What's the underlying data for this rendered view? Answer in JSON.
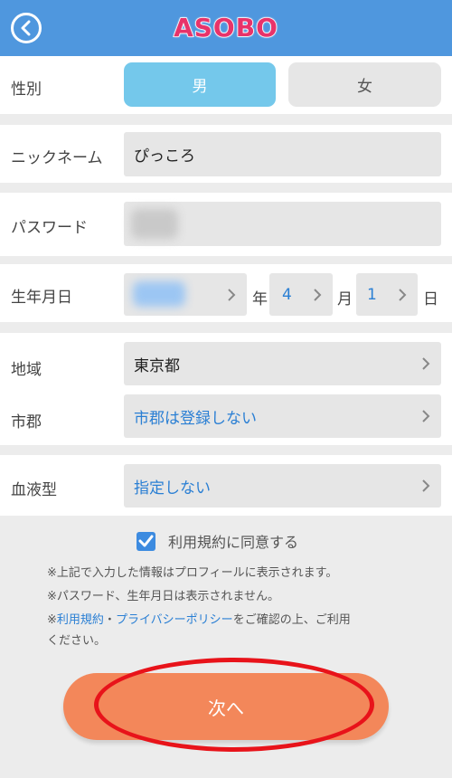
{
  "header": {
    "logo": "ASOBO"
  },
  "gender": {
    "label": "性別",
    "male": "男",
    "female": "女",
    "selected": "男"
  },
  "nickname": {
    "label": "ニックネーム",
    "value": "ぴっころ"
  },
  "password": {
    "label": "パスワード"
  },
  "birthday": {
    "label": "生年月日",
    "year_suffix": "年",
    "month": "4",
    "month_suffix": "月",
    "day": "1",
    "day_suffix": "日"
  },
  "region": {
    "label": "地域",
    "value": "東京都"
  },
  "city": {
    "label": "市郡",
    "value": "市郡は登録しない"
  },
  "blood": {
    "label": "血液型",
    "value": "指定しない"
  },
  "agree": {
    "label": "利用規約に同意する",
    "checked": true
  },
  "notes": {
    "line1": "※上記で入力した情報はプロフィールに表示されます。",
    "line2": "※パスワード、生年月日は表示されません。",
    "prefix": "※",
    "terms_link": "利用規約",
    "separator": "・",
    "privacy_link": "プライバシーポリシー",
    "suffix": "をご確認の上、ご利用",
    "line4": "ください。"
  },
  "next_button": "次へ",
  "colors": {
    "header": "#4f97de",
    "logo": "#e8336a",
    "selected_segment": "#74c8eb",
    "link": "#2a7fd4",
    "button": "#f3875a",
    "highlight": "#e8131a"
  }
}
